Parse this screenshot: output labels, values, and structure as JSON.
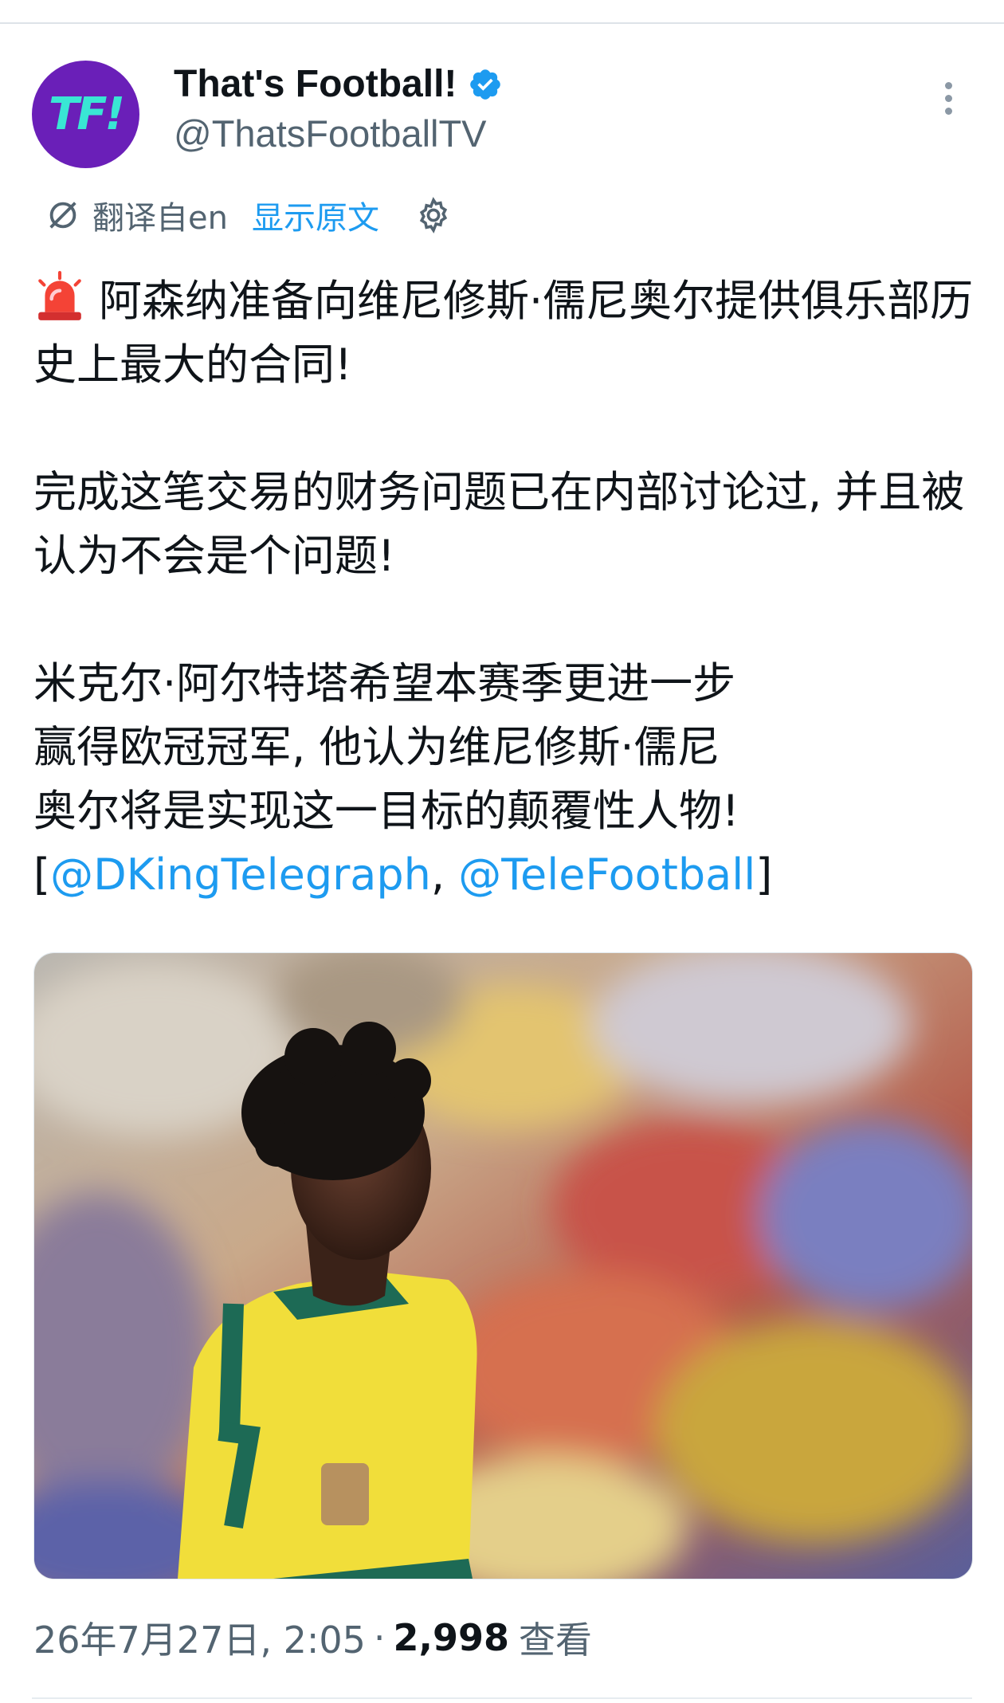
{
  "post": {
    "author": {
      "display_name": "That's Football!",
      "handle": "@ThatsFootballTV",
      "avatar_text": "TF!",
      "verified": true,
      "avatar_color": "#6a1fb8",
      "avatar_text_color": "#39e6d4"
    },
    "translation": {
      "label": "翻译自en",
      "show_original": "显示原文"
    },
    "body": {
      "p1": "阿森纳准备向维尼修斯·儒尼奥尔提供俱乐部历史上最大的合同!",
      "p2": "完成这笔交易的财务问题已在内部讨论过, 并且被认为不会是个问题!",
      "p3_line1": "米克尔·阿尔特塔希望本赛季更进一步",
      "p3_line2": "赢得欧冠冠军, 他认为维尼修斯·儒尼",
      "p3_line3": "奥尔将是实现这一目标的颠覆性人物!",
      "bracket_open": "[",
      "mention1": "@DKingTelegraph",
      "comma": ", ",
      "mention2": "@TeleFootball",
      "bracket_close": "]",
      "leading_emoji": "siren-icon"
    },
    "meta": {
      "datetime": "26年7月27日, 2:05",
      "separator": "·",
      "views": "2,998",
      "views_label": "查看"
    },
    "colors": {
      "link": "#1d9bf0",
      "secondary_text": "#536471",
      "primary_text": "#0f1419"
    }
  }
}
